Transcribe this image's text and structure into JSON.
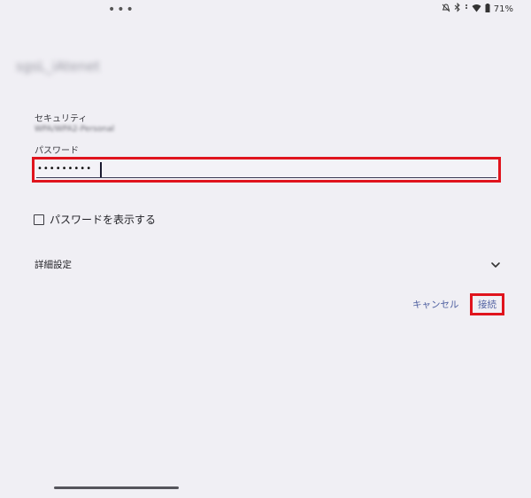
{
  "status_bar": {
    "battery_percent": "71%",
    "icons": [
      "notifications-off-icon",
      "bluetooth-icon",
      "signal-icon",
      "wifi-icon",
      "battery-icon"
    ]
  },
  "dialog": {
    "ssid": "sgsL_iAtenet",
    "security_label": "セキュリティ",
    "security_value": "WPA/WPA2-Personal",
    "password_label": "パスワード",
    "password_masked": "•••••••••",
    "show_password_label": "パスワードを表示する",
    "show_password_checked": false,
    "advanced_label": "詳細設定",
    "cancel_label": "キャンセル",
    "connect_label": "接続"
  },
  "colors": {
    "highlight": "#e0141d",
    "accent": "#4e5fa0",
    "background": "#f0eff4"
  }
}
